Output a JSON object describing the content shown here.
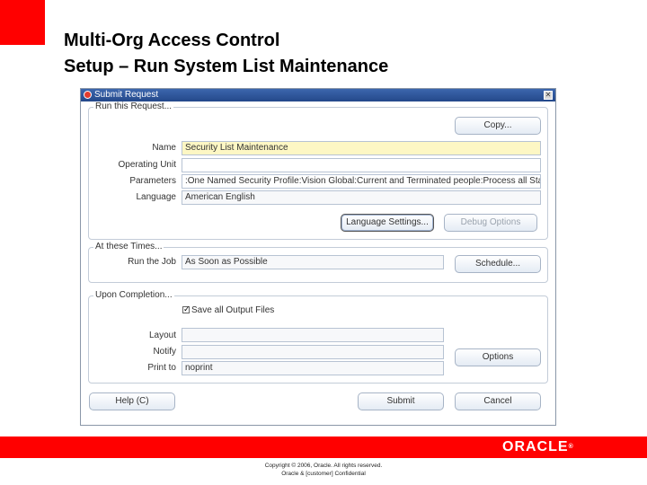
{
  "slide": {
    "title_line1": "Multi-Org Access Control",
    "title_line2": "Setup – Run System List Maintenance",
    "logo_text": "ORACLE",
    "logo_trademark": "®",
    "copyright_line1": "Copyright © 2006, Oracle. All rights reserved.",
    "copyright_line2": "Oracle & [customer] Confidential",
    "accent_color": "#ff0000"
  },
  "window": {
    "title": "Submit Request",
    "close_glyph": "✕"
  },
  "run_this_request": {
    "group_label": "Run this Request...",
    "copy_button": "Copy...",
    "name_label": "Name",
    "name_value": "Security List Maintenance",
    "operating_unit_label": "Operating Unit",
    "operating_unit_value": "",
    "parameters_label": "Parameters",
    "parameters_value": ":One Named Security Profile:Vision Global:Current and Terminated people:Process all Sta",
    "language_label": "Language",
    "language_value": "American English",
    "language_settings_button": "Language Settings...",
    "debug_options_button": "Debug Options"
  },
  "at_these_times": {
    "group_label": "At these Times...",
    "run_the_job_label": "Run the Job",
    "run_the_job_value": "As Soon as Possible",
    "schedule_button": "Schedule..."
  },
  "upon_completion": {
    "group_label": "Upon Completion...",
    "save_output_checked": true,
    "save_output_label": "Save all Output Files",
    "layout_label": "Layout",
    "layout_value": "",
    "notify_label": "Notify",
    "notify_value": "",
    "print_to_label": "Print to",
    "print_to_value": "noprint",
    "options_button": "Options"
  },
  "footer_buttons": {
    "help": "Help (C)",
    "submit": "Submit",
    "cancel": "Cancel"
  }
}
